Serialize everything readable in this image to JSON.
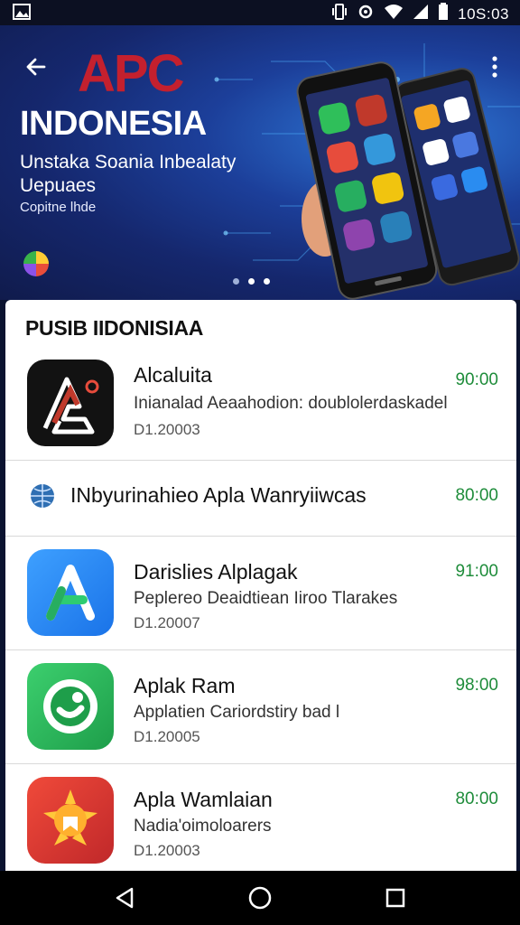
{
  "status_bar": {
    "time": "10S:03",
    "icons": [
      "image-icon",
      "vibrate-icon",
      "sync-icon",
      "wifi-icon",
      "signal-icon",
      "battery-icon"
    ]
  },
  "hero": {
    "logo_text": "APC",
    "title": "INDONESIA",
    "subtitle_line1": "Unstaka Soania Inbealaty",
    "subtitle_line2": "Uepuaes",
    "caption": "Copitne lhde",
    "slide_count": 3,
    "active_slide": 2,
    "colors": {
      "background": "#15276d",
      "accent": "#2f7ad9",
      "logo": "#c4202e"
    }
  },
  "section": {
    "title": "PUSIB IIDONISIAA"
  },
  "apps": [
    {
      "name": "Alcaluita",
      "description": "Inianalad Aeaahodion: doublolerdaskadel",
      "date": "D1.20003",
      "price": "90:00",
      "icon": "app-logo-a-icon"
    },
    {
      "name": "INbyurinahieo Apla Wanryiiwcas",
      "price": "80:00",
      "icon": "globe-icon"
    },
    {
      "name": "Darislies Alplagak",
      "description": "Peplereo Deaidtiean Iiroo Tlarakes",
      "date": "D1.20007",
      "price": "91:00",
      "icon": "app-store-a-icon"
    },
    {
      "name": "Aplak Ram",
      "description": "Applatien Cariordstiry bad l",
      "date": "D1.20005",
      "price": "98:00",
      "icon": "chat-bubble-icon"
    },
    {
      "name": "Apla Wamlaian",
      "description": "Nadia'oimoloarers",
      "date": "D1.20003",
      "price": "80:00",
      "icon": "sun-badge-icon"
    }
  ],
  "price_color": "#1e8c3a",
  "nav": {
    "buttons": [
      "back-icon",
      "home-icon",
      "recents-icon"
    ]
  }
}
